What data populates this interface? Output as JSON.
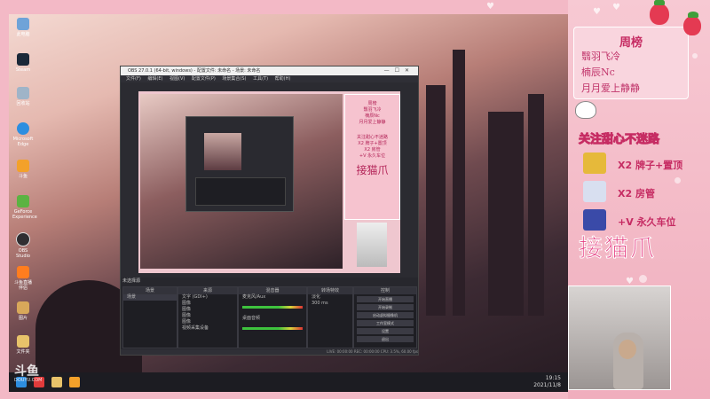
{
  "desktop": {
    "icons": [
      {
        "label": "此电脑",
        "color": "#6fa3d8"
      },
      {
        "label": "Steam",
        "color": "#1b2838"
      },
      {
        "label": "回收站",
        "color": "#9fb4c8"
      },
      {
        "label": "Microsoft Edge",
        "color": "#2d8ee0"
      },
      {
        "label": "斗鱼",
        "color": "#f3a12a"
      },
      {
        "label": "GeForce Experience",
        "color": "#5bb342"
      },
      {
        "label": "OBS Studio",
        "color": "#302e31"
      },
      {
        "label": "斗鱼直播伴侣",
        "color": "#ff7d1f"
      },
      {
        "label": "图片",
        "color": "#d8a85a"
      },
      {
        "label": "文件夹",
        "color": "#e8c36a"
      }
    ],
    "watermark": "斗鱼",
    "watermark_url": "DOUYU.COM",
    "clock_time": "19:15",
    "clock_date": "2021/11/8"
  },
  "obs": {
    "title": "OBS 27.0.1 (64-bit, windows) - 配置文件: 未命名 - 场景: 未命名",
    "menu": "文件(F)  编辑(E)  视图(V)  配置文件(P)  场景集合(S)  工具(T)  帮助(H)",
    "bottom_label": "未选择源",
    "docks": {
      "scenes": {
        "title": "场景",
        "items": [
          "场景"
        ]
      },
      "sources": {
        "title": "来源",
        "items": [
          "文字 (GDI+)",
          "图像",
          "图像",
          "图像",
          "图像",
          "视频采集设备"
        ]
      },
      "mixer": {
        "title": "混音器",
        "items": [
          "麦克风/Aux",
          "桌面音频"
        ]
      },
      "transitions": {
        "title": "转场特效",
        "items": [
          "淡化",
          "300 ms"
        ]
      },
      "controls": {
        "title": "控制",
        "buttons": [
          "开始直播",
          "开始录制",
          "启动虚拟摄像机",
          "工作室模式",
          "设置",
          "退出"
        ]
      }
    },
    "status": "LIVE: 00:00:00  REC: 00:00:00  CPU: 3.5%, 60.00 fps"
  },
  "overlay": {
    "board_title": "周榜",
    "board_entries": [
      "翳羽飞冷",
      "楠辰Nc",
      "月月爱上静静"
    ],
    "follow_text": "关注甜心不迷路",
    "gifts": [
      {
        "label": "X2 牌子+置顶",
        "color": "#e6b93a"
      },
      {
        "label": "X2 房管",
        "color": "#d8dff0"
      },
      {
        "label": "+V 永久车位",
        "color": "#3a4aa8"
      }
    ],
    "catch_text": "接猫爪"
  }
}
